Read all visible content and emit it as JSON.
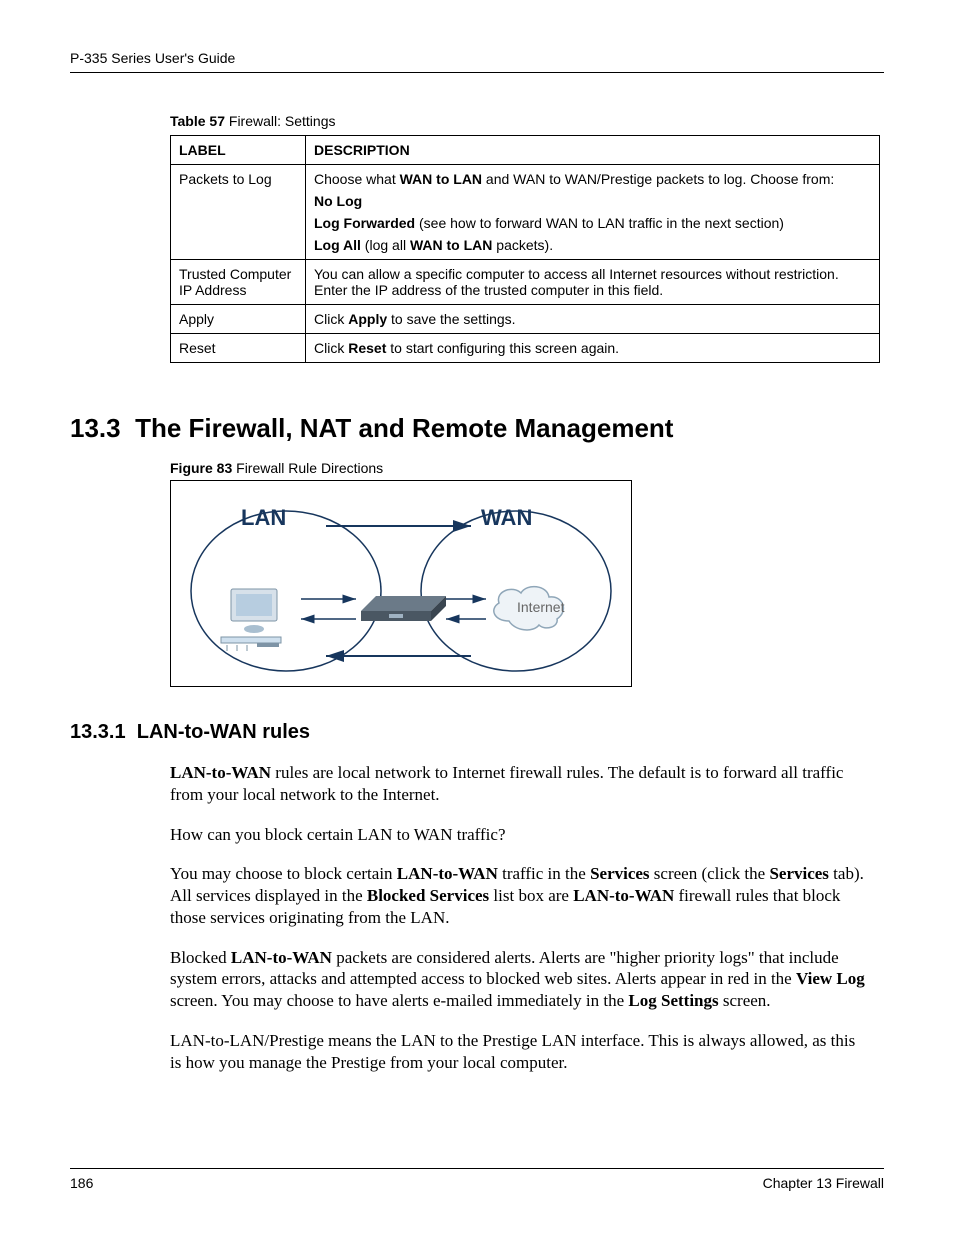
{
  "header": {
    "running_head": "P-335 Series User's Guide"
  },
  "table": {
    "caption_bold": "Table 57",
    "caption_rest": "   Firewall: Settings",
    "head": {
      "label": "LABEL",
      "desc": "DESCRIPTION"
    },
    "rows": [
      {
        "label": "Packets to Log",
        "desc_lines": [
          {
            "pre": "Choose what ",
            "b1": "WAN to LAN",
            "mid": " and WAN to WAN/Prestige packets to log. Choose from:",
            "b2": "",
            "post": ""
          },
          {
            "pre": "",
            "b1": "No Log",
            "mid": "",
            "b2": "",
            "post": ""
          },
          {
            "pre": "",
            "b1": "Log Forwarded",
            "mid": " (see how to forward WAN to LAN traffic in the next section)",
            "b2": "",
            "post": ""
          },
          {
            "pre": "",
            "b1": "Log All",
            "mid": " (log all ",
            "b2": "WAN to LAN",
            "post": " packets)."
          }
        ]
      },
      {
        "label": "Trusted Computer IP Address",
        "desc_lines": [
          {
            "pre": "You can allow a specific computer to access all Internet resources without restriction. Enter the IP address of the trusted computer in this field.",
            "b1": "",
            "mid": "",
            "b2": "",
            "post": ""
          }
        ]
      },
      {
        "label": "Apply",
        "desc_lines": [
          {
            "pre": "Click ",
            "b1": "Apply",
            "mid": " to save the settings.",
            "b2": "",
            "post": ""
          }
        ]
      },
      {
        "label": "Reset",
        "desc_lines": [
          {
            "pre": "Click ",
            "b1": "Reset",
            "mid": " to start configuring this screen again.",
            "b2": "",
            "post": ""
          }
        ]
      }
    ]
  },
  "section": {
    "number": "13.3",
    "title": "The Firewall, NAT and Remote Management"
  },
  "figure": {
    "caption_bold": "Figure 83",
    "caption_rest": "   Firewall Rule Directions",
    "lan": "LAN",
    "wan": "WAN",
    "internet": "Internet"
  },
  "subsection": {
    "number": "13.3.1",
    "title": "LAN-to-WAN rules"
  },
  "paragraphs": {
    "p1": {
      "b1": "LAN-to-WAN",
      "t1": " rules are local network to Internet firewall rules. The default is to forward all traffic from your local network to the Internet."
    },
    "p2": {
      "t1": "How can you block certain LAN to WAN traffic?"
    },
    "p3": {
      "t1": "You may choose to block certain ",
      "b1": "LAN-to-WAN",
      "t2": " traffic in the ",
      "b2": "Services",
      "t3": " screen (click the ",
      "b3": "Services",
      "t4": " tab). All services displayed in the ",
      "b4": "Blocked Services",
      "t5": " list box are ",
      "b5": "LAN-to-WAN",
      "t6": " firewall rules that block those services originating from the LAN."
    },
    "p4": {
      "t1": "Blocked ",
      "b1": "LAN-to-WAN",
      "t2": " packets are considered alerts. Alerts are \"higher priority logs\" that include system errors, attacks and attempted access to blocked web sites. Alerts appear in red in the ",
      "b2": "View Log",
      "t3": " screen. You may choose to have alerts e-mailed immediately in the ",
      "b3": "Log Settings",
      "t4": " screen."
    },
    "p5": {
      "t1": "LAN-to-LAN/Prestige means the LAN to the Prestige LAN interface. This is always allowed, as this is how you manage the Prestige from your local computer."
    }
  },
  "footer": {
    "page": "186",
    "chapter": "Chapter 13 Firewall"
  }
}
